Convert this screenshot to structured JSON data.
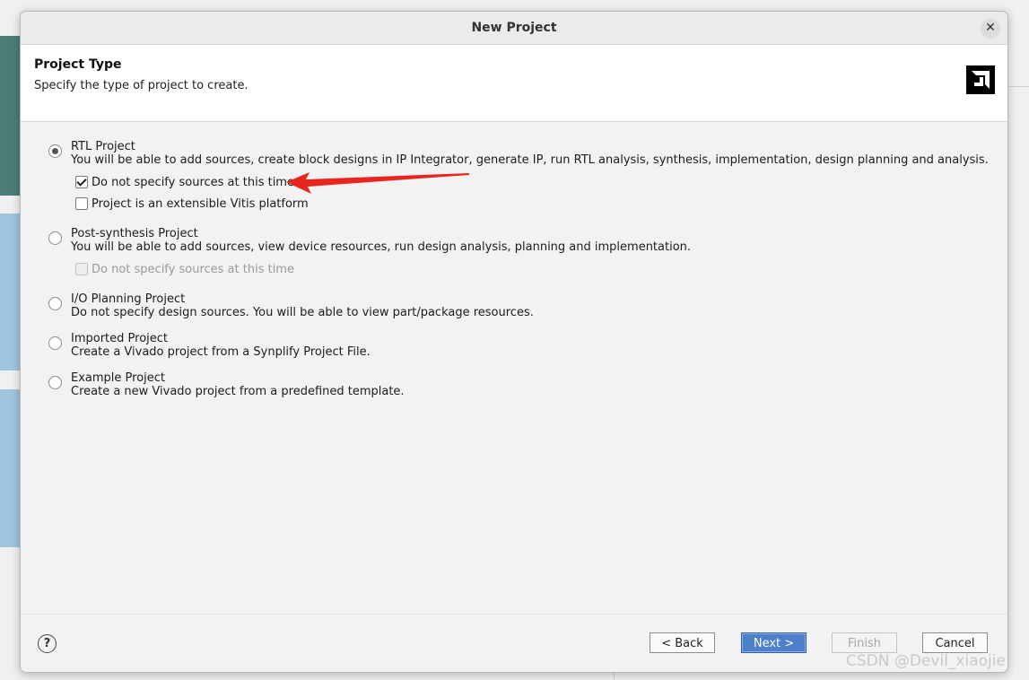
{
  "dialog": {
    "title": "New Project",
    "close_icon": "close-icon"
  },
  "header": {
    "title": "Project Type",
    "subtitle": "Specify the type of project to create.",
    "logo": "amd-logo"
  },
  "options": [
    {
      "title": "RTL Project",
      "description": "You will be able to add sources, create block designs in IP Integrator, generate IP, run RTL analysis, synthesis, implementation, design planning and analysis.",
      "selected": true,
      "checkboxes": [
        {
          "label": "Do not specify sources at this time",
          "checked": true,
          "enabled": true
        },
        {
          "label": "Project is an extensible Vitis platform",
          "checked": false,
          "enabled": true
        }
      ]
    },
    {
      "title": "Post-synthesis Project",
      "description": "You will be able to add sources, view device resources, run design analysis, planning and implementation.",
      "selected": false,
      "checkboxes": [
        {
          "label": "Do not specify sources at this time",
          "checked": false,
          "enabled": false
        }
      ]
    },
    {
      "title": "I/O Planning Project",
      "description": "Do not specify design sources. You will be able to view part/package resources.",
      "selected": false
    },
    {
      "title": "Imported Project",
      "description": "Create a Vivado project from a Synplify Project File.",
      "selected": false
    },
    {
      "title": "Example Project",
      "description": "Create a new Vivado project from a predefined template.",
      "selected": false
    }
  ],
  "footer": {
    "help_label": "?",
    "back_label": "< Back",
    "next_label": "Next >",
    "finish_label": "Finish",
    "cancel_label": "Cancel"
  },
  "colors": {
    "primary_button": "#4e7fcb",
    "annotation_arrow": "#e8261f"
  },
  "watermark": "CSDN @Devil_xiaojie"
}
